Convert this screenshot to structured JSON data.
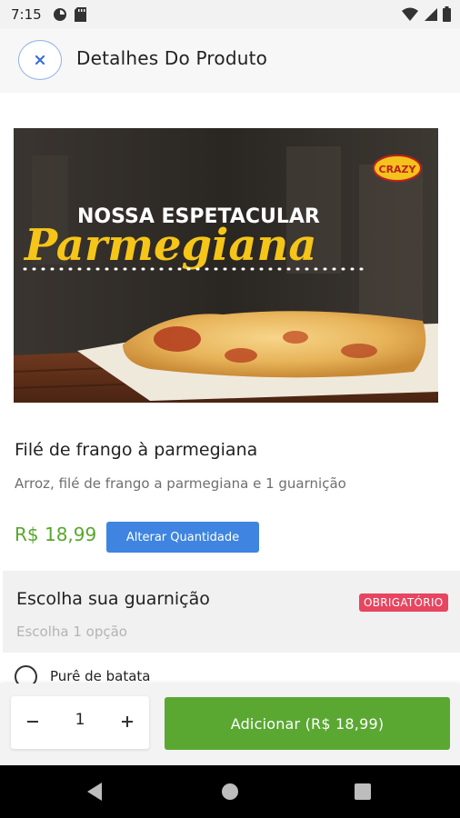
{
  "status_bar": {
    "time": "7:15",
    "left_icons": [
      "sync-icon",
      "sd-card-icon"
    ],
    "right_icons": [
      "wifi-icon",
      "signal-icon",
      "battery-icon"
    ]
  },
  "header": {
    "close_icon": "close-icon",
    "title": "Detalhes Do Produto"
  },
  "product_image": {
    "headline": "NOSSA ESPETACULAR",
    "script_title": "Parmegiana",
    "logo_text": "CRAZY"
  },
  "product": {
    "name": "Filé de frango à parmegiana",
    "description": "Arroz, filé de frango a parmegiana e 1 guarnição",
    "price": "R$ 18,99",
    "change_qty_label": "Alterar Quantidade"
  },
  "garnish_section": {
    "title": "Escolha sua guarnição",
    "badge": "OBRIGATÓRIO",
    "subtitle": "Escolha 1 opção",
    "options": [
      {
        "label": "Purê de batata",
        "selected": false
      }
    ]
  },
  "bottom_bar": {
    "quantity": "1",
    "minus": "−",
    "plus": "+",
    "add_label": "Adicionar (R$ 18,99)"
  },
  "nav_bar": {
    "icons": [
      "back-icon",
      "home-icon",
      "recents-icon"
    ]
  },
  "colors": {
    "accent_green": "#5aa832",
    "price_green": "#58a72c",
    "button_blue": "#3f84e0",
    "badge_red": "#e74660"
  }
}
